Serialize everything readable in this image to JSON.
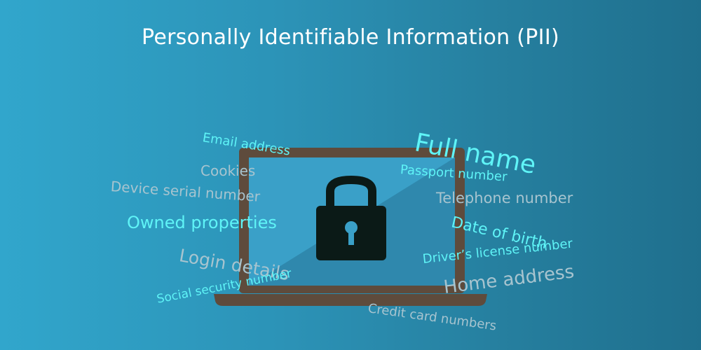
{
  "title": "Personally Identifiable Information (PII)",
  "colors": {
    "laptop_body": "#5e4b3c",
    "screen": "#3aa0c8",
    "screen_dark": "#2f88ad",
    "lock": "#0b1a17",
    "highlight_text": "#5ff4f7",
    "muted_text": "#a7c4cf"
  },
  "icon": "padlock-icon",
  "terms": {
    "email_address": "Email address",
    "full_name": "Full name",
    "cookies": "Cookies",
    "passport_number": "Passport number",
    "device_serial_number": "Device serial number",
    "telephone_number": "Telephone number",
    "owned_properties": "Owned properties",
    "date_of_birth": "Date of birth",
    "login_details": "Login details",
    "drivers_license_number": "Driver’s license number",
    "home_address": "Home address",
    "social_security_number": "Social security number",
    "credit_card_numbers": "Credit card numbers"
  }
}
